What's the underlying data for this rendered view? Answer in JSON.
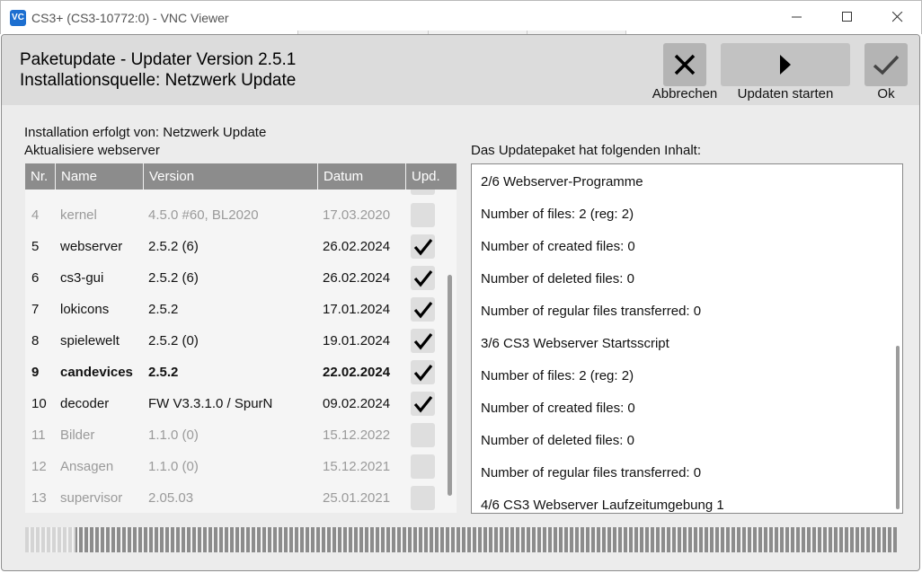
{
  "window": {
    "app_icon_text": "VC",
    "title": "CS3+ (CS3-10772:0) - VNC Viewer",
    "controls": [
      "minimize",
      "maximize",
      "close"
    ]
  },
  "header": {
    "title_line1": "Paketupdate - Updater Version 2.5.1",
    "title_line2": "Installationsquelle: Netzwerk Update",
    "buttons": {
      "cancel": {
        "label": "Abbrechen",
        "icon": "close-icon"
      },
      "start": {
        "label": "Updaten starten",
        "icon": "play-icon",
        "enabled": false
      },
      "ok": {
        "label": "Ok",
        "icon": "check-icon"
      }
    }
  },
  "left": {
    "source_text": "Installation erfolgt von: Netzwerk Update",
    "status_text": "Aktualisiere webserver",
    "columns": [
      "Nr.",
      "Name",
      "Version",
      "Datum",
      "Upd."
    ],
    "rows": [
      {
        "nr": "4",
        "name": "kernel",
        "version": "4.5.0 #60, BL2020",
        "date": "17.03.2020",
        "checked": false,
        "dim": true,
        "bold": false
      },
      {
        "nr": "5",
        "name": "webserver",
        "version": "2.5.2 (6)",
        "date": "26.02.2024",
        "checked": true,
        "dim": false,
        "bold": false
      },
      {
        "nr": "6",
        "name": "cs3-gui",
        "version": "2.5.2 (6)",
        "date": "26.02.2024",
        "checked": true,
        "dim": false,
        "bold": false
      },
      {
        "nr": "7",
        "name": "lokicons",
        "version": "2.5.2",
        "date": "17.01.2024",
        "checked": true,
        "dim": false,
        "bold": false
      },
      {
        "nr": "8",
        "name": "spielewelt",
        "version": "2.5.2 (0)",
        "date": "19.01.2024",
        "checked": true,
        "dim": false,
        "bold": false
      },
      {
        "nr": "9",
        "name": "candevices",
        "version": "2.5.2",
        "date": "22.02.2024",
        "checked": true,
        "dim": false,
        "bold": true
      },
      {
        "nr": "10",
        "name": "decoder",
        "version": "FW V3.3.1.0 / SpurN",
        "date": "09.02.2024",
        "checked": true,
        "dim": false,
        "bold": false
      },
      {
        "nr": "11",
        "name": "Bilder",
        "version": "1.1.0 (0)",
        "date": "15.12.2022",
        "checked": false,
        "dim": true,
        "bold": false
      },
      {
        "nr": "12",
        "name": "Ansagen",
        "version": "1.1.0 (0)",
        "date": "15.12.2021",
        "checked": false,
        "dim": true,
        "bold": false
      },
      {
        "nr": "13",
        "name": "supervisor",
        "version": "2.05.03",
        "date": "25.01.2021",
        "checked": false,
        "dim": true,
        "bold": false
      }
    ]
  },
  "right": {
    "label": "Das Updatepaket hat folgenden Inhalt:",
    "lines": [
      "2/6 Webserver-Programme",
      "Number of files: 2 (reg: 2)",
      "Number of created files: 0",
      "Number of deleted files: 0",
      "Number of regular files transferred: 0",
      "3/6 CS3 Webserver Startsscript",
      "Number of files: 2 (reg: 2)",
      "Number of created files: 0",
      "Number of deleted files: 0",
      "Number of regular files transferred: 0",
      "4/6 CS3 Webserver Laufzeitumgebung 1"
    ]
  },
  "progress": {
    "fraction": 1.0
  }
}
